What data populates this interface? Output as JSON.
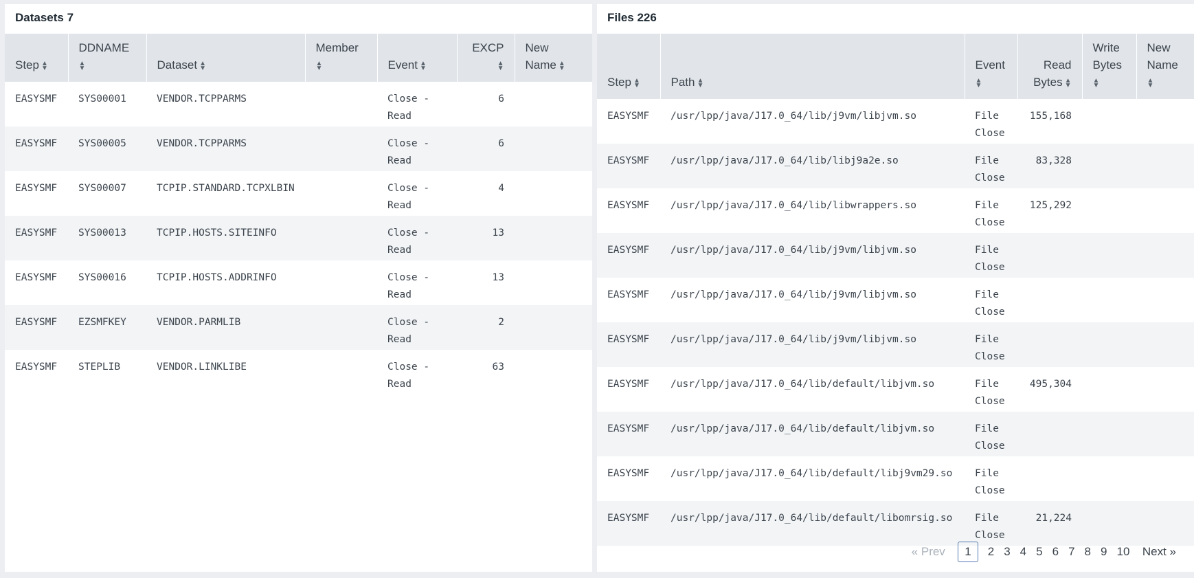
{
  "datasets": {
    "title": "Datasets 7",
    "columns": [
      "Step",
      "DDNAME",
      "Dataset",
      "Member",
      "Event",
      "EXCP",
      "New Name"
    ],
    "rows": [
      {
        "step": "EASYSMF",
        "ddname": "SYS00001",
        "dataset": "VENDOR.TCPPARMS",
        "member": "",
        "event": "Close - Read",
        "excp": "6",
        "newname": ""
      },
      {
        "step": "EASYSMF",
        "ddname": "SYS00005",
        "dataset": "VENDOR.TCPPARMS",
        "member": "",
        "event": "Close - Read",
        "excp": "6",
        "newname": ""
      },
      {
        "step": "EASYSMF",
        "ddname": "SYS00007",
        "dataset": "TCPIP.STANDARD.TCPXLBIN",
        "member": "",
        "event": "Close - Read",
        "excp": "4",
        "newname": ""
      },
      {
        "step": "EASYSMF",
        "ddname": "SYS00013",
        "dataset": "TCPIP.HOSTS.SITEINFO",
        "member": "",
        "event": "Close - Read",
        "excp": "13",
        "newname": ""
      },
      {
        "step": "EASYSMF",
        "ddname": "SYS00016",
        "dataset": "TCPIP.HOSTS.ADDRINFO",
        "member": "",
        "event": "Close - Read",
        "excp": "13",
        "newname": ""
      },
      {
        "step": "EASYSMF",
        "ddname": "EZSMFKEY",
        "dataset": "VENDOR.PARMLIB",
        "member": "",
        "event": "Close - Read",
        "excp": "2",
        "newname": ""
      },
      {
        "step": "EASYSMF",
        "ddname": "STEPLIB",
        "dataset": "VENDOR.LINKLIBE",
        "member": "",
        "event": "Close - Read",
        "excp": "63",
        "newname": ""
      }
    ]
  },
  "files": {
    "title": "Files 226",
    "columns": [
      "Step",
      "Path",
      "Event",
      "Read Bytes",
      "Write Bytes",
      "New Name"
    ],
    "rows": [
      {
        "step": "EASYSMF",
        "path": "/usr/lpp/java/J17.0_64/lib/j9vm/libjvm.so",
        "event": "File Close",
        "read": "155,168",
        "write": "",
        "newname": ""
      },
      {
        "step": "EASYSMF",
        "path": "/usr/lpp/java/J17.0_64/lib/libj9a2e.so",
        "event": "File Close",
        "read": "83,328",
        "write": "",
        "newname": ""
      },
      {
        "step": "EASYSMF",
        "path": "/usr/lpp/java/J17.0_64/lib/libwrappers.so",
        "event": "File Close",
        "read": "125,292",
        "write": "",
        "newname": ""
      },
      {
        "step": "EASYSMF",
        "path": "/usr/lpp/java/J17.0_64/lib/j9vm/libjvm.so",
        "event": "File Close",
        "read": "",
        "write": "",
        "newname": ""
      },
      {
        "step": "EASYSMF",
        "path": "/usr/lpp/java/J17.0_64/lib/j9vm/libjvm.so",
        "event": "File Close",
        "read": "",
        "write": "",
        "newname": ""
      },
      {
        "step": "EASYSMF",
        "path": "/usr/lpp/java/J17.0_64/lib/j9vm/libjvm.so",
        "event": "File Close",
        "read": "",
        "write": "",
        "newname": ""
      },
      {
        "step": "EASYSMF",
        "path": "/usr/lpp/java/J17.0_64/lib/default/libjvm.so",
        "event": "File Close",
        "read": "495,304",
        "write": "",
        "newname": ""
      },
      {
        "step": "EASYSMF",
        "path": "/usr/lpp/java/J17.0_64/lib/default/libjvm.so",
        "event": "File Close",
        "read": "",
        "write": "",
        "newname": ""
      },
      {
        "step": "EASYSMF",
        "path": "/usr/lpp/java/J17.0_64/lib/default/libj9vm29.so",
        "event": "File Close",
        "read": "",
        "write": "",
        "newname": ""
      },
      {
        "step": "EASYSMF",
        "path": "/usr/lpp/java/J17.0_64/lib/default/libomrsig.so",
        "event": "File Close",
        "read": "21,224",
        "write": "",
        "newname": ""
      }
    ],
    "pagination": {
      "prev": "« Prev",
      "pages": [
        "1",
        "2",
        "3",
        "4",
        "5",
        "6",
        "7",
        "8",
        "9",
        "10"
      ],
      "current": "1",
      "next": "Next »"
    }
  },
  "icons": {
    "sort": "sort-icon"
  }
}
